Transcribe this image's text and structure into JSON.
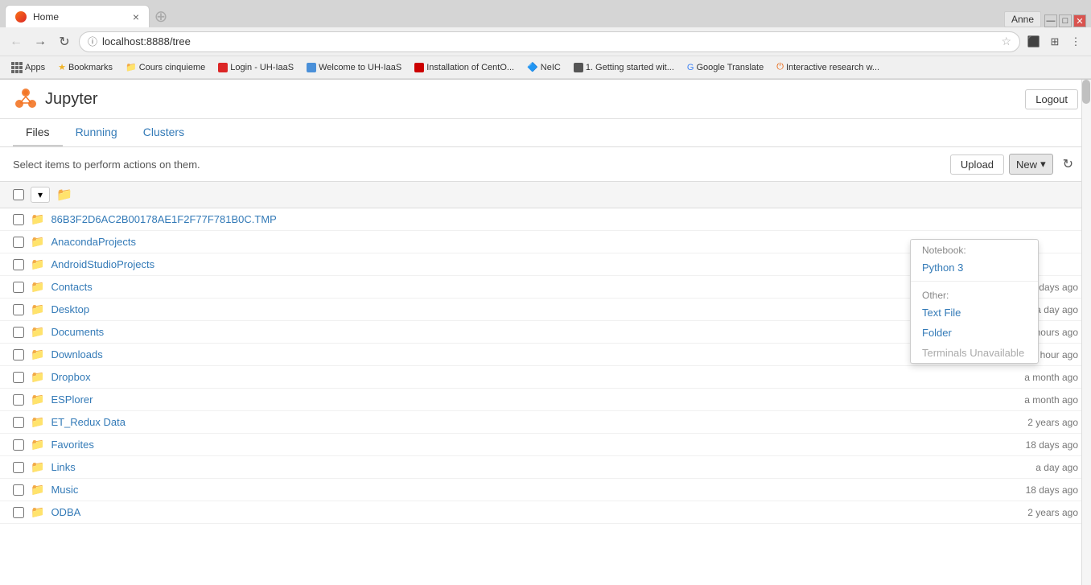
{
  "browser": {
    "tab_title": "Home",
    "url": "localhost:8888/tree",
    "user": "Anne",
    "bookmarks": [
      {
        "label": "Apps",
        "type": "apps"
      },
      {
        "label": "Bookmarks",
        "type": "star"
      },
      {
        "label": "Cours cinquieme",
        "type": "folder"
      },
      {
        "label": "Login - UH-IaaS",
        "type": "bookmark"
      },
      {
        "label": "Welcome to UH-IaaS",
        "type": "bookmark"
      },
      {
        "label": "Installation of CentO...",
        "type": "bookmark"
      },
      {
        "label": "NeIC",
        "type": "bookmark"
      },
      {
        "label": "1. Getting started wit...",
        "type": "bookmark"
      },
      {
        "label": "Google Translate",
        "type": "bookmark"
      },
      {
        "label": "Interactive research w...",
        "type": "bookmark"
      }
    ]
  },
  "jupyter": {
    "title": "Jupyter",
    "logout_label": "Logout",
    "tabs": [
      {
        "label": "Files",
        "active": true
      },
      {
        "label": "Running",
        "active": false
      },
      {
        "label": "Clusters",
        "active": false
      }
    ],
    "toolbar": {
      "select_text": "Select items to perform actions on them.",
      "upload_label": "Upload",
      "new_label": "New",
      "new_dropdown_arrow": "▾"
    },
    "files": [
      {
        "name": "86B3F2D6AC2B00178AE1F2F77F781B0C.TMP",
        "date": ""
      },
      {
        "name": "AnacondaProjects",
        "date": ""
      },
      {
        "name": "AndroidStudioProjects",
        "date": ""
      },
      {
        "name": "Contacts",
        "date": "10 days ago"
      },
      {
        "name": "Desktop",
        "date": "a day ago"
      },
      {
        "name": "Documents",
        "date": "5 hours ago"
      },
      {
        "name": "Downloads",
        "date": "an hour ago"
      },
      {
        "name": "Dropbox",
        "date": "a month ago"
      },
      {
        "name": "ESPlorer",
        "date": "a month ago"
      },
      {
        "name": "ET_Redux Data",
        "date": "2 years ago"
      },
      {
        "name": "Favorites",
        "date": "18 days ago"
      },
      {
        "name": "Links",
        "date": "a day ago"
      },
      {
        "name": "Music",
        "date": "18 days ago"
      },
      {
        "name": "ODBA",
        "date": "2 years ago"
      }
    ],
    "new_menu": {
      "notebook_label": "Notebook:",
      "python3_label": "Python 3",
      "other_label": "Other:",
      "text_file_label": "Text File",
      "folder_label": "Folder",
      "terminals_label": "Terminals Unavailable"
    }
  },
  "colors": {
    "link_blue": "#337ab7",
    "folder_yellow": "#dcaa3a",
    "accent_orange": "#f97316"
  }
}
